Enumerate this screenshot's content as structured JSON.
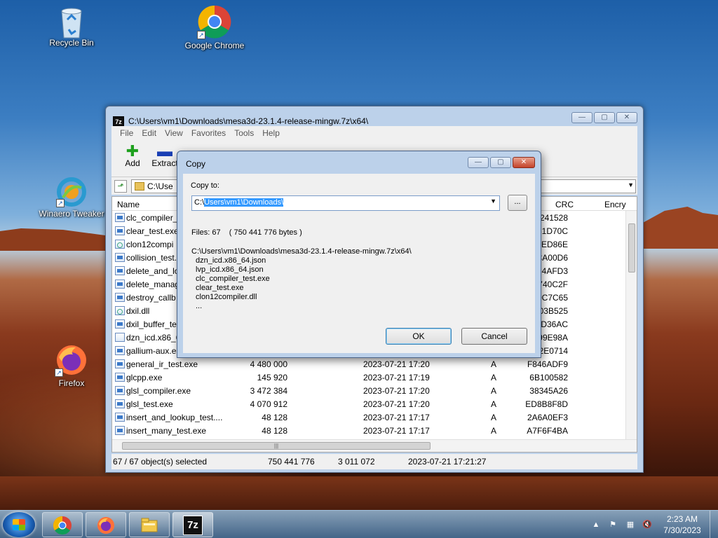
{
  "desktop": {
    "icons": [
      {
        "label": "Recycle Bin"
      },
      {
        "label": "Google Chrome"
      },
      {
        "label": "Winaero Tweaker"
      },
      {
        "label": "Firefox"
      }
    ]
  },
  "main_window": {
    "title": "C:\\Users\\vm1\\Downloads\\mesa3d-23.1.4-release-mingw.7z\\x64\\",
    "app_icon": "7z",
    "caption": {
      "minimize": "▭",
      "maximize": "▢",
      "close": "✕"
    },
    "menu": [
      "File",
      "Edit",
      "View",
      "Favorites",
      "Tools",
      "Help"
    ],
    "toolbar": [
      {
        "label": "Add",
        "icon": "plus-icon"
      },
      {
        "label": "Extract",
        "icon": "minus-icon"
      }
    ],
    "address": "C:\\Use",
    "columns": {
      "name": "Name",
      "crc": "CRC",
      "encrypted": "Encry"
    },
    "rows": [
      {
        "name": "clc_compiler_",
        "size": "",
        "modified": "",
        "attr": "",
        "crc": "4241528",
        "icon": "exe"
      },
      {
        "name": "clear_test.exe",
        "size": "",
        "modified": "",
        "attr": "",
        "crc": "61D70C",
        "icon": "exe"
      },
      {
        "name": "clon12compi",
        "size": "",
        "modified": "",
        "attr": "",
        "crc": "D0ED86E",
        "icon": "dll"
      },
      {
        "name": "collision_test.",
        "size": "",
        "modified": "",
        "attr": "",
        "crc": "CA00D6",
        "icon": "exe"
      },
      {
        "name": "delete_and_lo",
        "size": "",
        "modified": "",
        "attr": "",
        "crc": "C14AFD3",
        "icon": "exe"
      },
      {
        "name": "delete_manag",
        "size": "",
        "modified": "",
        "attr": "",
        "crc": "5740C2F",
        "icon": "exe"
      },
      {
        "name": "destroy_callb",
        "size": "",
        "modified": "",
        "attr": "",
        "crc": "E0C7C65",
        "icon": "exe"
      },
      {
        "name": "dxil.dll",
        "size": "",
        "modified": "",
        "attr": "",
        "crc": "D03B525",
        "icon": "dll"
      },
      {
        "name": "dxil_buffer_te",
        "size": "",
        "modified": "",
        "attr": "",
        "crc": "1D36AC",
        "icon": "exe"
      },
      {
        "name": "dzn_icd.x86_6",
        "size": "",
        "modified": "",
        "attr": "",
        "crc": "A99E98A",
        "icon": "doc"
      },
      {
        "name": "gallium-aux.e",
        "size": "",
        "modified": "",
        "attr": "",
        "crc": "22E0714",
        "icon": "exe"
      },
      {
        "name": "general_ir_test.exe",
        "size": "4 480 000",
        "modified": "2023-07-21 17:20",
        "attr": "A",
        "crc": "F846ADF9",
        "icon": "exe"
      },
      {
        "name": "glcpp.exe",
        "size": "145 920",
        "modified": "2023-07-21 17:19",
        "attr": "A",
        "crc": "6B100582",
        "icon": "exe"
      },
      {
        "name": "glsl_compiler.exe",
        "size": "3 472 384",
        "modified": "2023-07-21 17:20",
        "attr": "A",
        "crc": "38345A26",
        "icon": "exe"
      },
      {
        "name": "glsl_test.exe",
        "size": "4 070 912",
        "modified": "2023-07-21 17:20",
        "attr": "A",
        "crc": "ED8B8F8D",
        "icon": "exe"
      },
      {
        "name": "insert_and_lookup_test....",
        "size": "48 128",
        "modified": "2023-07-21 17:17",
        "attr": "A",
        "crc": "2A6A0EF3",
        "icon": "exe"
      },
      {
        "name": "insert_many_test.exe",
        "size": "48 128",
        "modified": "2023-07-21 17:17",
        "attr": "A",
        "crc": "A7F6F4BA",
        "icon": "exe"
      }
    ],
    "hscroll_grip": "|||",
    "status": {
      "selected": "67 / 67 object(s) selected",
      "size": "750 441 776",
      "packed": "3 011 072",
      "modified": "2023-07-21 17:21:27"
    }
  },
  "copy_dialog": {
    "title": "Copy",
    "copy_to_label": "Copy to:",
    "dest_prefix": "C:\\",
    "dest_selected": "Users\\vm1\\Downloads\\",
    "browse_label": "...",
    "files_info": "Files: 67    ( 750 441 776 bytes )",
    "source_path": "C:\\Users\\vm1\\Downloads\\mesa3d-23.1.4-release-mingw.7z\\x64\\",
    "file_list": [
      "dzn_icd.x86_64.json",
      "lvp_icd.x86_64.json",
      "clc_compiler_test.exe",
      "clear_test.exe",
      "clon12compiler.dll",
      "..."
    ],
    "ok_label": "OK",
    "cancel_label": "Cancel"
  },
  "taskbar": {
    "apps": [
      "chrome-icon",
      "firefox-icon",
      "file-explorer-icon",
      "7zip-icon"
    ],
    "seven_zip_label": "7z",
    "clock_time": "2:23 AM",
    "clock_date": "7/30/2023"
  }
}
